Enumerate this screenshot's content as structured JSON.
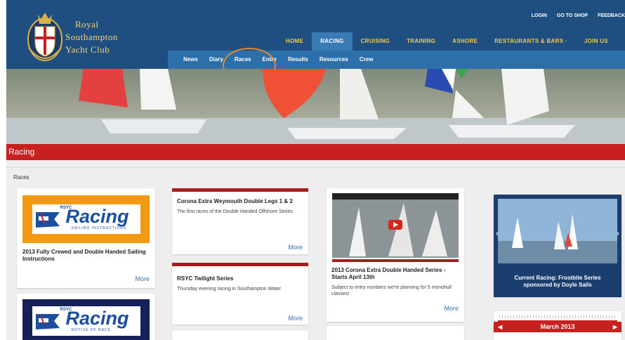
{
  "header": {
    "club_name": [
      "Royal",
      "Southampton",
      "Yacht Club"
    ],
    "utility_nav": [
      "LOGIN",
      "GO TO SHOP",
      "FEEDBACK"
    ],
    "main_nav": [
      "HOME",
      "RACING",
      "CRUISING",
      "TRAINING",
      "ASHORE",
      "RESTAURANTS & BARS ·",
      "JOIN US"
    ],
    "sub_nav": [
      "News",
      "Diary",
      "Races",
      "Entry",
      "Results",
      "Resources",
      "Crew"
    ]
  },
  "page_title": "Racing",
  "breadcrumb": "Races",
  "cards": {
    "sailing_instructions": {
      "logo_word": "Racing",
      "logo_small": "RSYC",
      "logo_sub": "SAILING INSTRUCTIONS",
      "title": "2013 Fully Crewed and Double Handed Sailing Instructions",
      "more": "More"
    },
    "notice_of_race": {
      "logo_word": "Racing",
      "logo_small": "RSYC",
      "logo_sub": "NOTICE OF RACE"
    },
    "weymouth": {
      "title": "Corona Extra Weymouth Double Legs 1 & 2",
      "text": "The first races of the Double Handed Offshore Series",
      "more": "More"
    },
    "twilight": {
      "title": "RSYC Twilight Series",
      "text": "Thursday evening racing in Southampton Water",
      "more": "More"
    },
    "video": {
      "title": "2013 Corona Extra Double Handed Series - Starts April 13th",
      "text": "Subject to entry numbers we're planning for 5 monohull classes!",
      "more": "More"
    },
    "current_racing": {
      "caption": "Current Racing: Frostbite Series sponsored by Doyle Sails"
    },
    "calendar": {
      "month": "March 2013"
    }
  },
  "colors": {
    "header_blue": "#1e4f80",
    "accent_red": "#c8201e",
    "nav_gold": "#f5c84a",
    "link_blue": "#3a6fb0"
  }
}
